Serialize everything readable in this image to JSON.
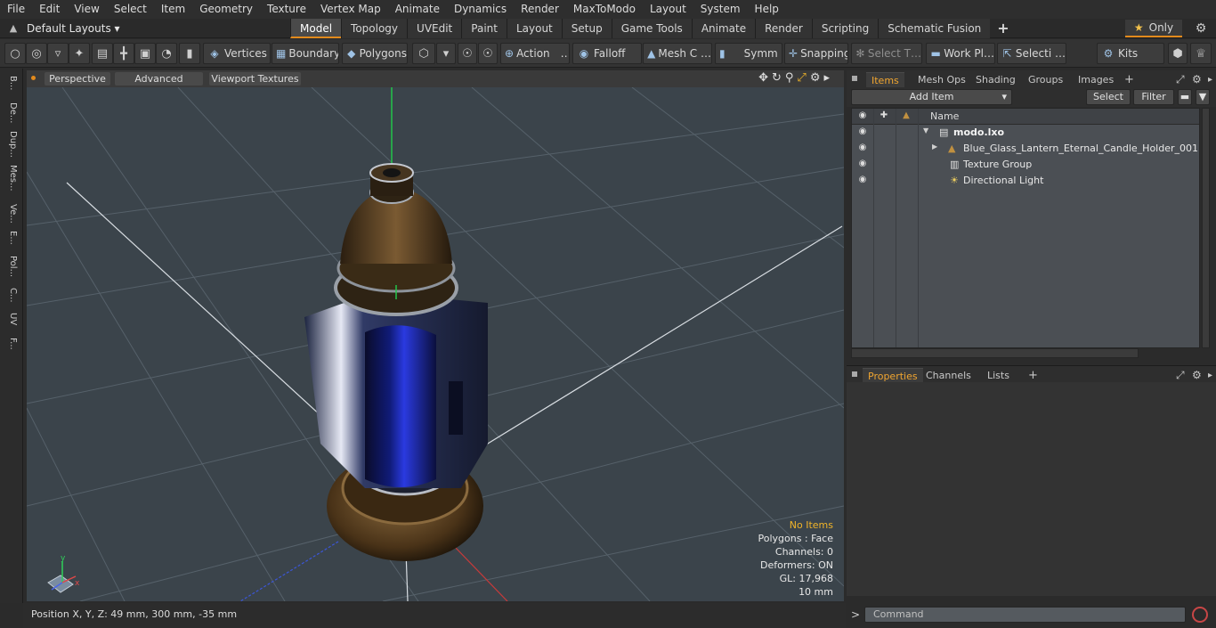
{
  "menu": [
    "File",
    "Edit",
    "View",
    "Select",
    "Item",
    "Geometry",
    "Texture",
    "Vertex Map",
    "Animate",
    "Dynamics",
    "Render",
    "MaxToModo",
    "Layout",
    "System",
    "Help"
  ],
  "layouts": {
    "selector": "Default Layouts ▾",
    "tabs": [
      "Model",
      "Topology",
      "UVEdit",
      "Paint",
      "Layout",
      "Setup",
      "Game Tools",
      "Animate",
      "Render",
      "Scripting",
      "Schematic Fusion"
    ],
    "active_tab": "Model",
    "add": "+",
    "only_label": "Only"
  },
  "toolbar": {
    "vertices": "Vertices",
    "boundary": "Boundary",
    "polygons": "Polygons",
    "action": "Action",
    "action_more": "…",
    "falloff": "Falloff",
    "mesh_c": "Mesh C …",
    "symm": "Symm …",
    "snapping": "Snapping",
    "select_t": "Select T…",
    "work_pl": "Work Pl…",
    "selecti": "Selecti …",
    "kits": "Kits"
  },
  "leftbar": [
    "B...",
    "De...",
    "Dup...",
    "Mes...",
    "Ve...",
    "E...",
    "Pol...",
    "C...",
    "UV",
    "F..."
  ],
  "viewport": {
    "perspective": "Perspective",
    "advanced": "Advanced",
    "viewport_textures": "Viewport Textures",
    "info": {
      "selection": "No Items",
      "polygons": "Polygons : Face",
      "channels": "Channels: 0",
      "deformers": "Deformers: ON",
      "gl": "GL: 17,968",
      "scale": "10 mm"
    }
  },
  "status": {
    "position": "Position X, Y, Z:  49 mm, 300 mm, -35 mm"
  },
  "items_panel": {
    "tabs": [
      "Items",
      "Mesh Ops",
      "Shading",
      "Groups",
      "Images"
    ],
    "active_tab": "Items",
    "add_tab": "+",
    "add_item": "Add Item",
    "select": "Select",
    "filter": "Filter",
    "column_name": "Name",
    "rows": [
      {
        "label": "modo.lxo",
        "bold": true
      },
      {
        "label": "Blue_Glass_Lantern_Eternal_Candle_Holder_001",
        "bold": false
      },
      {
        "label": "Texture Group",
        "bold": false
      },
      {
        "label": "Directional Light",
        "bold": false
      }
    ]
  },
  "properties_panel": {
    "tabs": [
      "Properties",
      "Channels",
      "Lists"
    ],
    "active_tab": "Properties",
    "add_tab": "+"
  },
  "command": {
    "placeholder": "Command"
  },
  "colors": {
    "accent": "#e28a1c",
    "viewport_bg": "#3b444b",
    "info_warning": "#f0b429",
    "glass_blue": "#1a2fc8"
  }
}
